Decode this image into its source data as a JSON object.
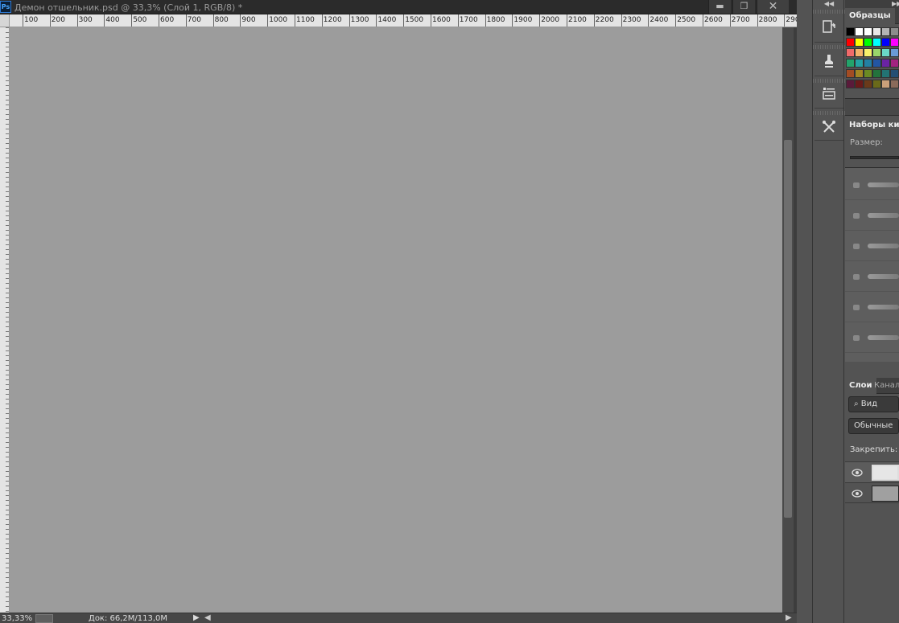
{
  "document": {
    "app_badge": "Ps",
    "title": "Демон отшельник.psd @ 33,3% (Слой 1, RGB/8) *",
    "window_buttons": {
      "minimize": "▬",
      "restore": "❐",
      "close": "✕"
    }
  },
  "ruler": {
    "top_ticks": [
      "100",
      "200",
      "300",
      "400",
      "500",
      "600",
      "700",
      "800",
      "900",
      "1000",
      "1100",
      "1200",
      "1300",
      "1400",
      "1500",
      "1600",
      "1700",
      "1800",
      "1900",
      "2000",
      "2100",
      "2200",
      "2300",
      "2400",
      "2500",
      "2600",
      "2700",
      "2800",
      "290"
    ]
  },
  "status": {
    "zoom": "33,33%",
    "doc_size": "Док: 66,2M/113,0M",
    "menu_arrow": "▶",
    "scroll_left": "◀",
    "scroll_right": "▶"
  },
  "tool_column": {
    "collapse": "◀◀",
    "tools": [
      "history-icon",
      "clone-stamp-icon",
      "layer-comps-icon",
      "tool-presets-icon"
    ]
  },
  "panel": {
    "collapse": "▶▶",
    "swatches_tab": "Образцы",
    "swatch_colors": [
      "#000000",
      "#ffffff",
      "#ffffff",
      "#e8e8e8",
      "#b4b4b4",
      "#8c8c8c",
      "#ff0000",
      "#ffff00",
      "#00ff00",
      "#00ffff",
      "#0000ff",
      "#ff00ff",
      "#f06a6a",
      "#f4b26a",
      "#f7f06a",
      "#9ad76a",
      "#6ad7c6",
      "#6a9ad7",
      "#23a36b",
      "#23a3a3",
      "#2380a3",
      "#2356a3",
      "#6a23a3",
      "#a3237f",
      "#a34c23",
      "#a38623",
      "#6b8b23",
      "#23733c",
      "#237373",
      "#234e73",
      "#5a1a3a",
      "#6a1a1a",
      "#6a3a1a",
      "#6a6a1a",
      "#caa07a",
      "#8a6a5a"
    ],
    "brush_presets_tab": "Наборы кистей",
    "size_label": "Размер:",
    "layers_tabs": [
      "Слои",
      "Каналы"
    ],
    "filter_label": "⌕ Вид",
    "blend_mode": "Обычные",
    "lock_label": "Закрепить:"
  }
}
